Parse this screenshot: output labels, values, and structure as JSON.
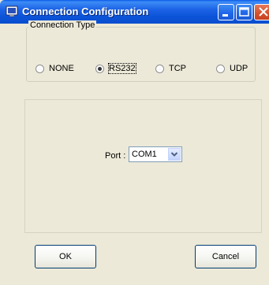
{
  "window": {
    "title": "Connection Configuration",
    "icons": {
      "app": "computer-monitor-icon",
      "minimize": "minimize-icon",
      "maximize": "maximize-icon",
      "close": "close-icon"
    },
    "colors": {
      "titlebar": "#0a53d8",
      "close_button": "#d4502c",
      "client_background": "#ece9d8"
    }
  },
  "connection_type": {
    "legend": "Connection Type",
    "options": [
      {
        "label": "NONE",
        "selected": false
      },
      {
        "label": "RS232",
        "selected": true
      },
      {
        "label": "TCP",
        "selected": false
      },
      {
        "label": "UDP",
        "selected": false
      }
    ]
  },
  "port": {
    "label": "Port :",
    "value": "COM1",
    "dropdown_icon": "chevron-down-icon"
  },
  "buttons": {
    "ok": "OK",
    "cancel": "Cancel"
  }
}
